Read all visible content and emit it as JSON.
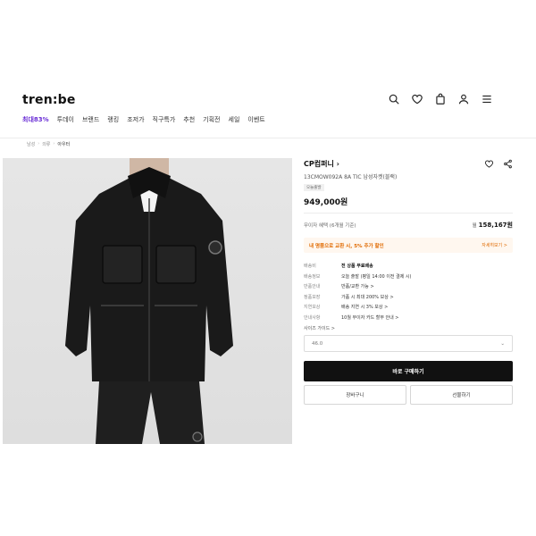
{
  "header": {
    "logo": "tren:be",
    "icons": [
      "search-icon",
      "heart-icon",
      "bag-icon",
      "user-icon",
      "menu-icon"
    ]
  },
  "nav": {
    "items": [
      "최대83%",
      "투데이",
      "브랜드",
      "랭킹",
      "조저가",
      "직구특가",
      "추천",
      "기획전",
      "세일",
      "이벤트"
    ],
    "accent": "#6b2fd6"
  },
  "breadcrumb": [
    "남성",
    "의류",
    "아우터"
  ],
  "product": {
    "brand": "CP컴퍼니",
    "name": "13CMOW092A 8A TIC 남성자켓(블랙)",
    "tag": "오늘출발",
    "price": "949,000원",
    "installment_label": "무이자 혜택 (6개월 기준)",
    "installment_prefix": "월",
    "installment_value": "158,167원",
    "promo_text": "내 명품으로 교환 시, 5% 추가 할인",
    "promo_link": "자세히보기 >",
    "promo_color": "#e06a00"
  },
  "details": [
    {
      "key": "배송비",
      "value": "전 상품 무료배송"
    },
    {
      "key": "배송정보",
      "value": "오늘 출발 (평일 14:00 이전 결제 시)"
    },
    {
      "key": "반품안내",
      "value": "반품/교환 가능 >"
    },
    {
      "key": "정품보장",
      "value": "가품 시 최대 200% 보상 >"
    },
    {
      "key": "지연보상",
      "value": "배송 지연 시 3% 보상 >"
    },
    {
      "key": "안내사항",
      "value": "10월 무이자 카드 할부 안내 >"
    }
  ],
  "size": {
    "label": "사이즈 가이드 >",
    "selected": "46.0"
  },
  "buttons": {
    "buy": "바로 구매하기",
    "cart": "장바구니",
    "gift": "선물하기"
  }
}
